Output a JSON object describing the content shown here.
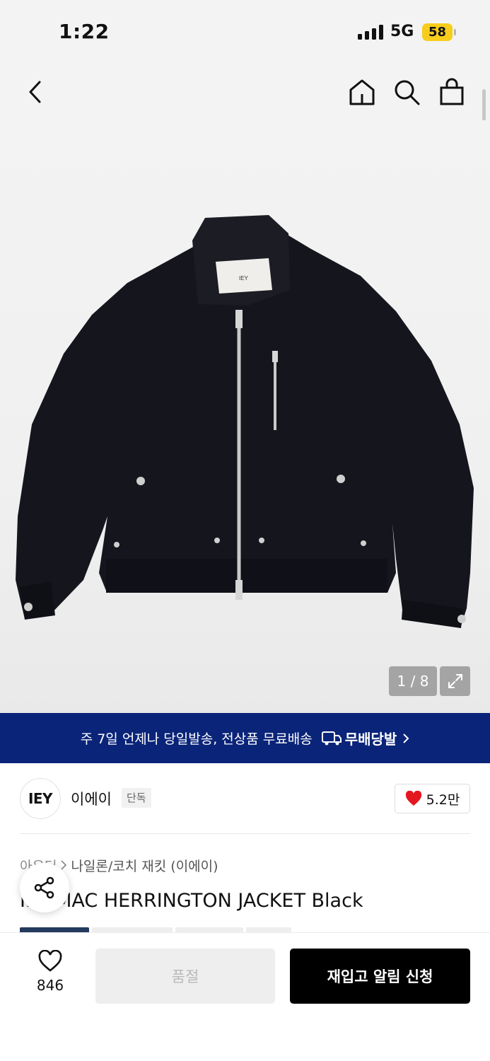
{
  "status_bar": {
    "time": "1:22",
    "network": "5G",
    "battery": "58"
  },
  "nav": {
    "back_icon": "chevron-left-icon",
    "home_icon": "home-icon",
    "search_icon": "search-icon",
    "cart_icon": "bag-icon"
  },
  "gallery": {
    "counter": "1 / 8",
    "label_text": "IEY",
    "expand_icon": "expand-icon"
  },
  "delivery_banner": {
    "text": "주 7일 언제나 당일발송, 전상품 무료배송",
    "brand": "무배당발",
    "icon": "delivery-truck-icon"
  },
  "brand": {
    "logo": "IEY",
    "name": "이에이",
    "badge": "단독",
    "likes": "5.2만"
  },
  "breadcrumb": {
    "category": "아우터",
    "subcategory": "나일론/코치 재킷 (이에이)"
  },
  "product": {
    "name": "IEY MAC HERRINGTON JACKET Black"
  },
  "bottom_bar": {
    "wish_count": "846",
    "soldout_label": "품절",
    "restock_label": "재입고 알림 신청"
  },
  "colors": {
    "banner": "#0a2479",
    "like_heart": "#e4161f",
    "battery": "#f7cd1d",
    "primary_button": "#000000",
    "disabled_button": "#eeeeee"
  }
}
